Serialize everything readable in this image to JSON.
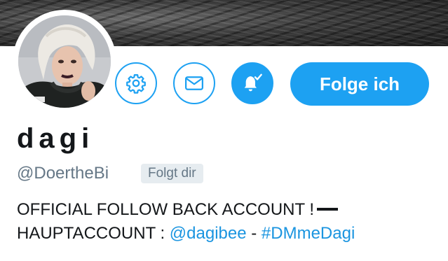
{
  "profile": {
    "name": "dagi",
    "handle": "@DoertheBi",
    "follows_you_badge": "Folgt dir",
    "bio_line1": "OFFICIAL FOLLOW BACK ACCOUNT !",
    "bio_line2_prefix": "HAUPTACCOUNT : ",
    "bio_mention": "@dagibee",
    "bio_separator": " - ",
    "bio_hashtag": "#DMmeDagi"
  },
  "actions": {
    "follow_label": "Folge ich",
    "settings_icon": "gear-icon",
    "message_icon": "envelope-icon",
    "notifications_icon": "bell-check-icon"
  },
  "colors": {
    "accent": "#1da1f2",
    "link": "#1b95e0",
    "text": "#14171a",
    "muted": "#657786",
    "badge_bg": "#e6ecf0"
  }
}
